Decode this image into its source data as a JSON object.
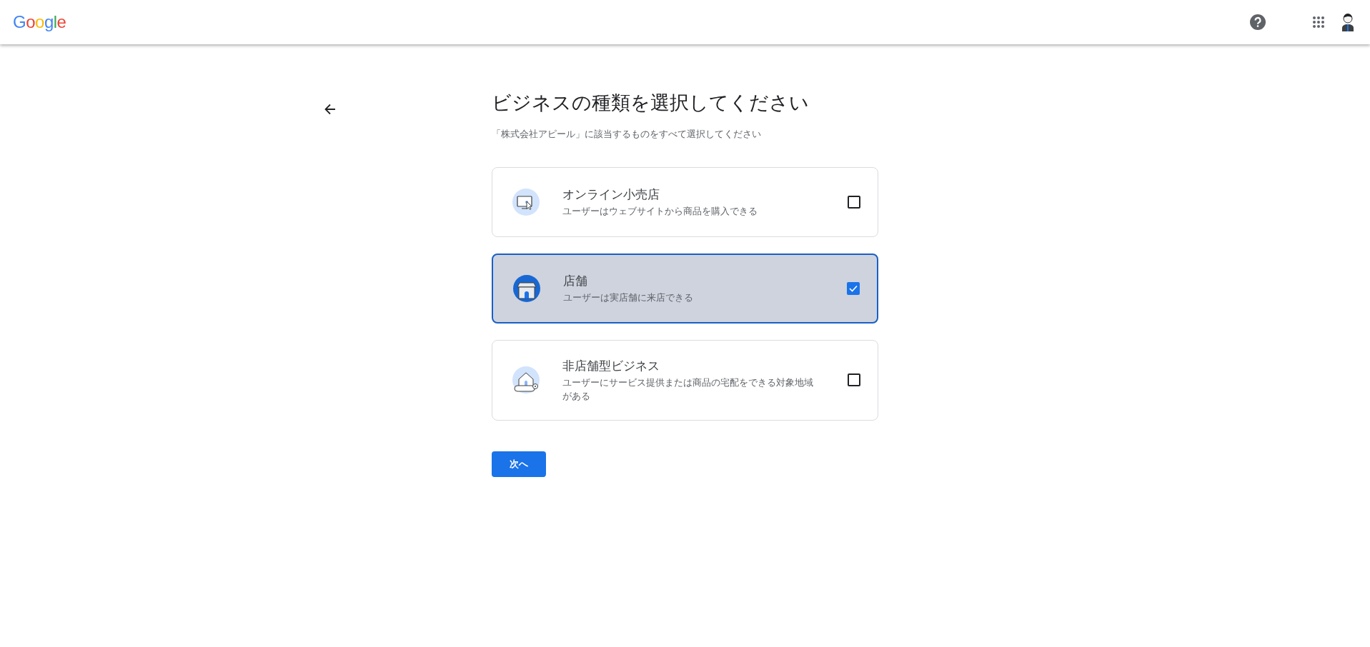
{
  "header": {
    "logo": "Google"
  },
  "title": "ビジネスの種類を選択してください",
  "subtitle": "「株式会社アピール」に該当するものをすべて選択してください",
  "options": [
    {
      "kind": "online",
      "label": "オンライン小売店",
      "description": "ユーザーはウェブサイトから商品を購入できる",
      "checked": false
    },
    {
      "kind": "store",
      "label": "店舗",
      "description": "ユーザーは実店舗に来店できる",
      "checked": true
    },
    {
      "kind": "service",
      "label": "非店舗型ビジネス",
      "description": "ユーザーにサービス提供または商品の宅配をできる対象地域がある",
      "checked": false
    }
  ],
  "next_button": "次へ"
}
